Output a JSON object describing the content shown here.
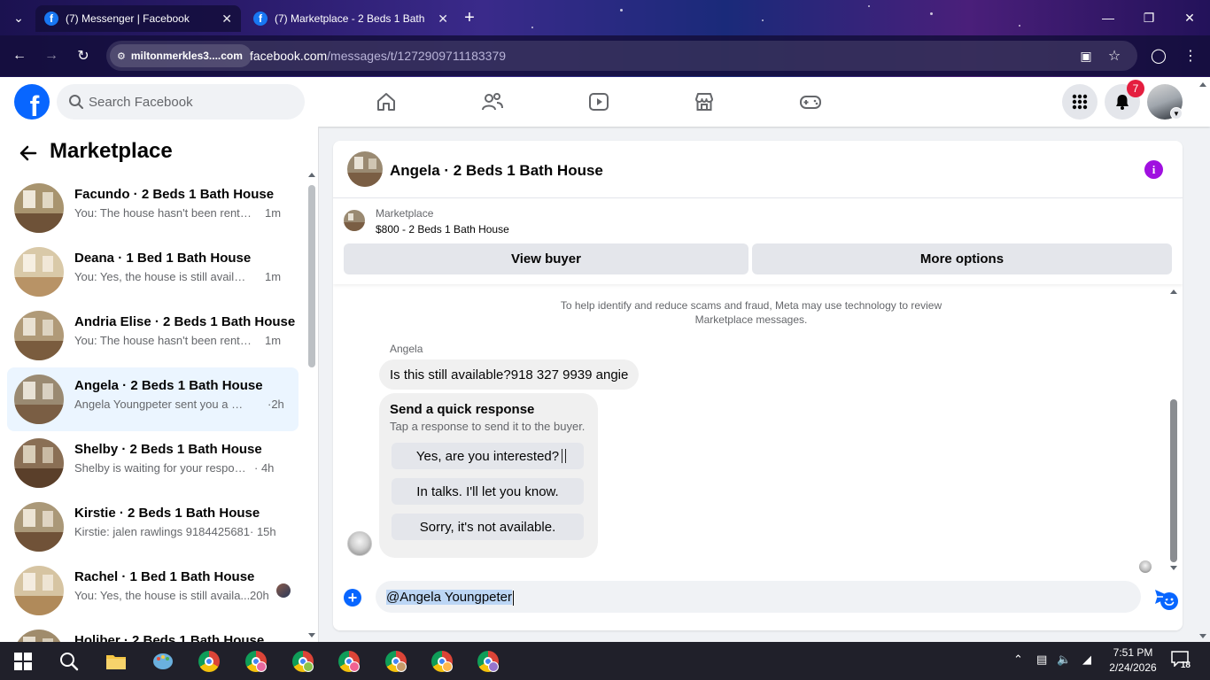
{
  "browser": {
    "tabs": [
      {
        "title": "(7) Messenger | Facebook",
        "active": true
      },
      {
        "title": "(7) Marketplace - 2 Beds 1 Bath",
        "active": false
      }
    ],
    "site_chip": "miltonmerkles3....com",
    "url_host": "facebook.com",
    "url_path": "/messages/t/1272909711183379"
  },
  "fb_header": {
    "search_placeholder": "Search Facebook",
    "notification_count": "7",
    "nav_icons": [
      "home-icon",
      "friends-icon",
      "video-icon",
      "marketplace-icon",
      "gaming-icon"
    ]
  },
  "sidebar": {
    "title": "Marketplace",
    "conversations": [
      {
        "name": "Facundo · 2 Beds 1 Bath House",
        "preview": "You: The house hasn't been rented...",
        "time": "1m",
        "selected": false
      },
      {
        "name": "Deana · 1 Bed 1 Bath House",
        "preview": "You: Yes, the house is still available...",
        "time": "1m",
        "selected": false
      },
      {
        "name": "Andria Elise · 2 Beds 1 Bath House",
        "preview": "You: The house hasn't been rented...",
        "time": "1m",
        "selected": false
      },
      {
        "name": "Angela · 2 Beds 1 Bath House",
        "preview": "Angela Youngpeter sent you a mes...",
        "time": "·2h",
        "selected": true
      },
      {
        "name": "Shelby · 2 Beds 1 Bath House",
        "preview": "Shelby is waiting for your response.",
        "time": "· 4h",
        "selected": false
      },
      {
        "name": "Kirstie · 2 Beds 1 Bath House",
        "preview": "Kirstie: jalen rawlings 9184425681",
        "time": "· 15h",
        "selected": false
      },
      {
        "name": "Rachel · 1 Bed 1 Bath House",
        "preview": "You: Yes, the house is still availa...",
        "time": "20h",
        "selected": false
      },
      {
        "name": "Holiber · 2 Beds 1 Bath House",
        "preview": "",
        "time": "",
        "selected": false
      }
    ]
  },
  "chat": {
    "title": "Angela · 2 Beds 1 Bath House",
    "listing_label": "Marketplace",
    "listing_price": "$800 - 2 Beds 1 Bath House",
    "view_buyer": "View buyer",
    "more_options": "More options",
    "scam_notice": "To help identify and reduce scams and fraud, Meta may use technology to review Marketplace messages.",
    "sender_name": "Angela",
    "message": "Is this still available?918 327 9939 angie",
    "quick_title": "Send a quick response",
    "quick_subtitle": "Tap a response to send it to the buyer.",
    "quick_responses": [
      "Yes, are you interested?",
      "In talks. I'll let you know.",
      "Sorry, it's not available."
    ],
    "composer_text": "@Angela Youngpeter"
  },
  "taskbar": {
    "time": "7:51 PM",
    "date": "2/24/2026",
    "notifications": "18"
  },
  "colors": {
    "fb_blue": "#0866ff",
    "selected_bg": "#ebf5ff",
    "badge_red": "#e41e3f",
    "info_purple": "#a010e0"
  }
}
